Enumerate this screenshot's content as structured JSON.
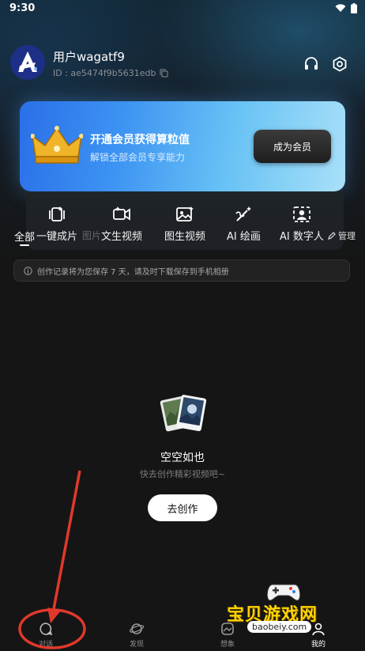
{
  "status": {
    "time": "9:30"
  },
  "user": {
    "name": "用户wagatf9",
    "id": "ID : ae5474f9b5631edb"
  },
  "vip": {
    "title": "开通会员获得算粒值",
    "subtitle": "解锁全部会员专享能力",
    "button": "成为会员"
  },
  "tools": [
    {
      "label": "一键成片",
      "icon": "film-edit-icon"
    },
    {
      "label": "文生视频",
      "icon": "video-camera-icon"
    },
    {
      "label": "图生视频",
      "icon": "image-icon"
    },
    {
      "label": "AI 绘画",
      "icon": "magic-wand-icon"
    },
    {
      "label": "AI 数字人",
      "icon": "digital-human-icon"
    }
  ],
  "tabs": {
    "all": "全部",
    "images": "图片",
    "manage": "管理"
  },
  "notice": "创作记录将为您保存 7 天，请及时下载保存到手机相册",
  "empty": {
    "title": "空空如也",
    "subtitle": "快去创作精彩视频吧~",
    "button": "去创作"
  },
  "nav": [
    {
      "label": "对话",
      "icon": "chat-icon"
    },
    {
      "label": "发现",
      "icon": "planet-icon"
    },
    {
      "label": "想象",
      "icon": "imagine-icon"
    },
    {
      "label": "我的",
      "icon": "profile-icon"
    }
  ],
  "watermark": {
    "text": "宝贝游戏网",
    "url": "baobeiy.com"
  },
  "colors": {
    "annotation": "#e0392b",
    "vip_gradient_start": "#2a6fe8",
    "vip_gradient_end": "#a9e0f8"
  }
}
